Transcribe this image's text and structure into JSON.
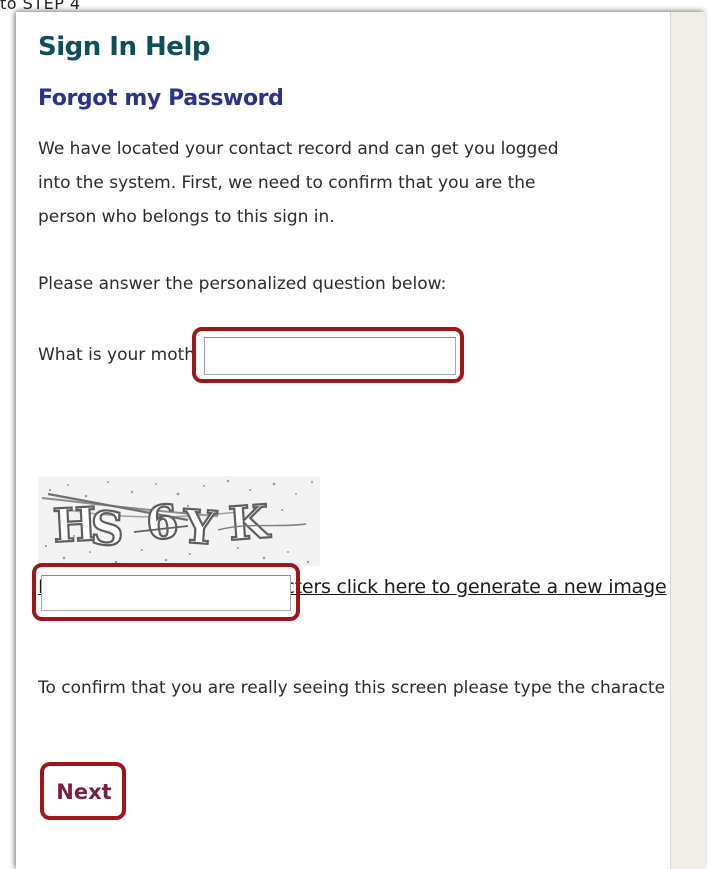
{
  "top_crop_text": "to STEP 4",
  "page": {
    "title": "Sign In Help",
    "subtitle": "Forgot my Password",
    "intro_lines": [
      "We have located your contact record and can get you logged",
      "into the system. First, we need to confirm that you are the",
      "person who belongs to this sign in."
    ],
    "prompt": "Please answer the personalized question below:",
    "question_label": "What is your moth",
    "answer_value": "",
    "captcha_text": "HS 6YK",
    "captcha_refresh_link": "If you can't read the characters click here to generate a new image",
    "captcha_value": "",
    "confirm_instruction": "To confirm that you are really seeing this screen please type the characte",
    "next_label": "Next"
  },
  "colors": {
    "title": "#0d4f5c",
    "subtitle": "#29348a",
    "highlight": "#a0141c",
    "next": "#7a2040",
    "side_strip": "#efeee7"
  },
  "icons": [
    "captcha-image"
  ]
}
